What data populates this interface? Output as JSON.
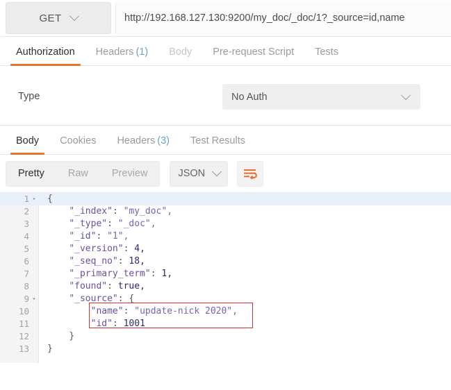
{
  "request": {
    "method": "GET",
    "url": "http://192.168.127.130:9200/my_doc/_doc/1?_source=id,name",
    "tabs": [
      {
        "label": "Authorization",
        "badge": "",
        "state": "active"
      },
      {
        "label": "Headers",
        "badge": "(1)",
        "state": "normal"
      },
      {
        "label": "Body",
        "badge": "",
        "state": "dim"
      },
      {
        "label": "Pre-request Script",
        "badge": "",
        "state": "normal"
      },
      {
        "label": "Tests",
        "badge": "",
        "state": "normal"
      }
    ],
    "auth": {
      "type_label": "Type",
      "selected": "No Auth"
    }
  },
  "response": {
    "tabs": [
      {
        "label": "Body",
        "badge": "",
        "state": "active"
      },
      {
        "label": "Cookies",
        "badge": "",
        "state": "normal"
      },
      {
        "label": "Headers",
        "badge": "(3)",
        "state": "normal"
      },
      {
        "label": "Test Results",
        "badge": "",
        "state": "normal"
      }
    ],
    "view_modes": [
      {
        "label": "Pretty",
        "state": "active"
      },
      {
        "label": "Raw",
        "state": "normal"
      },
      {
        "label": "Preview",
        "state": "normal"
      }
    ],
    "format": "JSON",
    "wrap_icon": "word-wrap-icon",
    "body_lines": [
      {
        "n": "1",
        "fold": "▾",
        "highlight": true,
        "indent": 0,
        "key": "",
        "value": "{",
        "type": "brace"
      },
      {
        "n": "2",
        "fold": "",
        "highlight": false,
        "indent": 1,
        "key": "\"_index\"",
        "value": "\"my_doc\",",
        "type": "string"
      },
      {
        "n": "3",
        "fold": "",
        "highlight": false,
        "indent": 1,
        "key": "\"_type\"",
        "value": "\"_doc\",",
        "type": "string"
      },
      {
        "n": "4",
        "fold": "",
        "highlight": false,
        "indent": 1,
        "key": "\"_id\"",
        "value": "\"1\",",
        "type": "string"
      },
      {
        "n": "5",
        "fold": "",
        "highlight": false,
        "indent": 1,
        "key": "\"_version\"",
        "value": "4,",
        "type": "number"
      },
      {
        "n": "6",
        "fold": "",
        "highlight": false,
        "indent": 1,
        "key": "\"_seq_no\"",
        "value": "18,",
        "type": "number"
      },
      {
        "n": "7",
        "fold": "",
        "highlight": false,
        "indent": 1,
        "key": "\"_primary_term\"",
        "value": "1,",
        "type": "number"
      },
      {
        "n": "8",
        "fold": "",
        "highlight": false,
        "indent": 1,
        "key": "\"found\"",
        "value": "true,",
        "type": "number"
      },
      {
        "n": "9",
        "fold": "▾",
        "highlight": false,
        "indent": 1,
        "key": "\"_source\"",
        "value": "{",
        "type": "brace"
      },
      {
        "n": "10",
        "fold": "",
        "highlight": false,
        "indent": 2,
        "key": "\"name\"",
        "value": "\"update-nick 2020\",",
        "type": "string"
      },
      {
        "n": "11",
        "fold": "",
        "highlight": false,
        "indent": 2,
        "key": "\"id\"",
        "value": "1001",
        "type": "number"
      },
      {
        "n": "12",
        "fold": "",
        "highlight": false,
        "indent": 1,
        "key": "",
        "value": "}",
        "type": "brace"
      },
      {
        "n": "13",
        "fold": "",
        "highlight": false,
        "indent": 0,
        "key": "",
        "value": "}",
        "type": "brace"
      }
    ],
    "annotation": {
      "name": "red-highlight-box",
      "color": "#d6302c"
    }
  }
}
